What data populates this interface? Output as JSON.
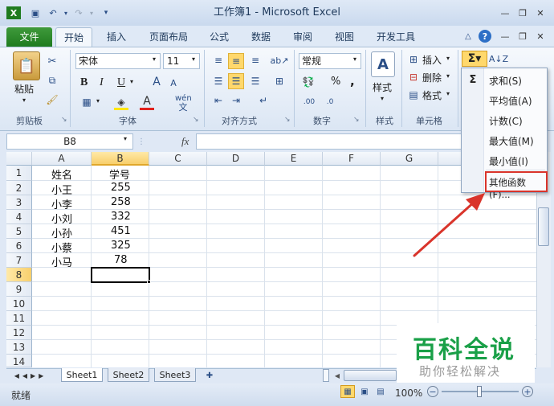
{
  "window": {
    "title": "工作簿1 - Microsoft Excel"
  },
  "tabs": {
    "file": "文件",
    "items": [
      "开始",
      "插入",
      "页面布局",
      "公式",
      "数据",
      "审阅",
      "视图",
      "开发工具"
    ]
  },
  "ribbon": {
    "clipboard": {
      "paste": "粘贴",
      "label": "剪贴板"
    },
    "font": {
      "name": "宋体",
      "size": "11",
      "bold": "B",
      "italic": "I",
      "underline": "U",
      "wen": "wén",
      "label": "字体"
    },
    "alignment": {
      "label": "对齐方式"
    },
    "number": {
      "format": "常规",
      "percent": "%",
      "comma": ",",
      "label": "数字"
    },
    "styles": {
      "label": "样式"
    },
    "cells": {
      "insert": "插入",
      "delete": "删除",
      "format": "格式",
      "label": "单元格"
    }
  },
  "formula_bar": {
    "name_box": "B8",
    "fx": "fx",
    "value": ""
  },
  "grid": {
    "columns": [
      "A",
      "B",
      "C",
      "D",
      "E",
      "F",
      "G"
    ],
    "rows": [
      "1",
      "2",
      "3",
      "4",
      "5",
      "6",
      "7",
      "8",
      "9",
      "10",
      "11",
      "12",
      "13",
      "14"
    ],
    "data": [
      [
        "姓名",
        "学号"
      ],
      [
        "小王",
        "255"
      ],
      [
        "小李",
        "258"
      ],
      [
        "小刘",
        "332"
      ],
      [
        "小孙",
        "451"
      ],
      [
        "小蔡",
        "325"
      ],
      [
        "小马",
        "78"
      ]
    ],
    "selected_cell": "B8"
  },
  "sheets": [
    "Sheet1",
    "Sheet2",
    "Sheet3"
  ],
  "status": {
    "ready": "就绪",
    "zoom": "100%"
  },
  "autosum_menu": {
    "items": [
      "求和(S)",
      "平均值(A)",
      "计数(C)",
      "最大值(M)",
      "最小值(I)"
    ],
    "more": "其他函数(F)..."
  },
  "watermark": {
    "line1": "百科全说",
    "line2": "助你轻松解决"
  },
  "colors": {
    "accent": "#1f7b1f",
    "highlight": "#d9342b",
    "selection_fill": "#ffd86c",
    "watermark": "#1aa048"
  }
}
